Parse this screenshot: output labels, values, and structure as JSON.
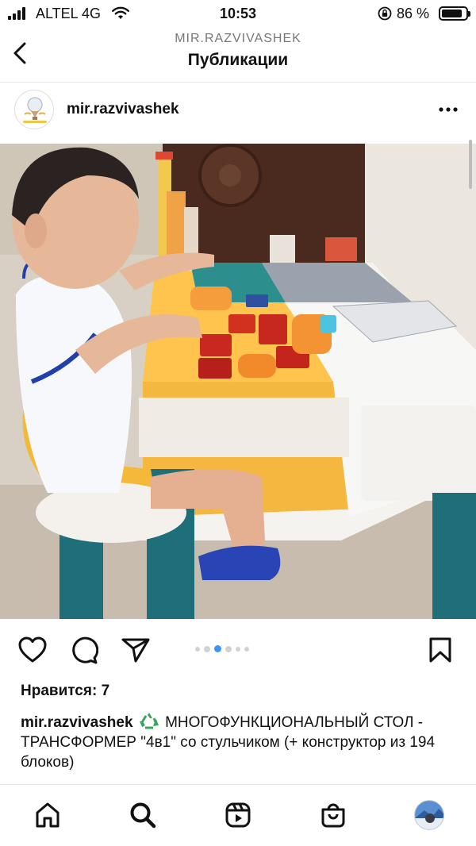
{
  "status_bar": {
    "carrier": "ALTEL 4G",
    "time": "10:53",
    "battery_percent": "86 %",
    "battery_level": 0.86
  },
  "header": {
    "account_handle": "MIR.RAZVIVASHEK",
    "title": "Публикации"
  },
  "post": {
    "username": "mir.razvivashek",
    "carousel": {
      "count": 6,
      "active_index": 2
    },
    "likes": "Нравится: 7",
    "caption_user": "mir.razvivashek",
    "caption_text": "МНОГОФУНКЦИОНАЛЬНЫЙ СТОЛ - ТРАНСФОРМЕР \"4в1\" со стульчиком (+ конструктор из 194 блоков)"
  },
  "icons": {
    "back": "chevron-left-icon",
    "more": "more-horizontal-icon",
    "like": "heart-icon",
    "comment": "comment-icon",
    "share": "send-icon",
    "save": "bookmark-icon",
    "tabs": [
      "home-icon",
      "search-icon",
      "reels-icon",
      "shop-icon",
      "profile-avatar"
    ]
  },
  "colors": {
    "text": "#111111",
    "muted": "#777777",
    "recycle_green": "#3aa65b"
  }
}
